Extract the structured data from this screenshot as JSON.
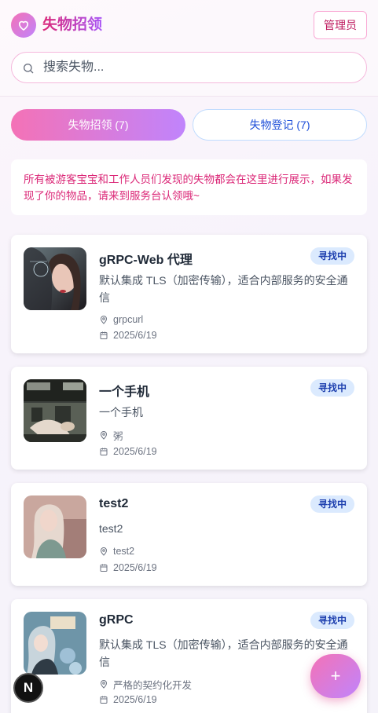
{
  "app": {
    "title": "失物招领",
    "admin_label": "管理员"
  },
  "search": {
    "placeholder": "搜索失物..."
  },
  "tabs": [
    {
      "label": "失物招领 (7)",
      "active": true
    },
    {
      "label": "失物登记 (7)",
      "active": false
    }
  ],
  "notice": "所有被游客宝宝和工作人员们发现的失物都会在这里进行展示，如果发现了你的物品，请来到服务台认领哦~",
  "items": [
    {
      "title": "gRPC-Web 代理",
      "status": "寻找中",
      "desc": "默认集成 TLS（加密传输），适合内部服务的安全通信",
      "location": "grpcurl",
      "date": "2025/6/19",
      "image": "photo-girl-portrait"
    },
    {
      "title": "一个手机",
      "status": "寻找中",
      "desc": "一个手机",
      "location": "粥",
      "date": "2025/6/19",
      "image": "photo-office-scene"
    },
    {
      "title": "test2",
      "status": "寻找中",
      "desc": "test2",
      "location": "test2",
      "date": "2025/6/19",
      "image": "photo-blonde-girl"
    },
    {
      "title": "gRPC",
      "status": "寻找中",
      "desc": "默认集成 TLS（加密传输），适合内部服务的安全通信",
      "location": "严格的契约化开发",
      "date": "2025/6/19",
      "image": "photo-anime-girl"
    }
  ],
  "fab": {
    "label": "+"
  },
  "dev_badge": {
    "label": "N"
  },
  "colors": {
    "brand_pink": "#db2777",
    "brand_purple": "#a855f7",
    "badge_bg": "#dbeafe",
    "badge_text": "#1e40af"
  }
}
